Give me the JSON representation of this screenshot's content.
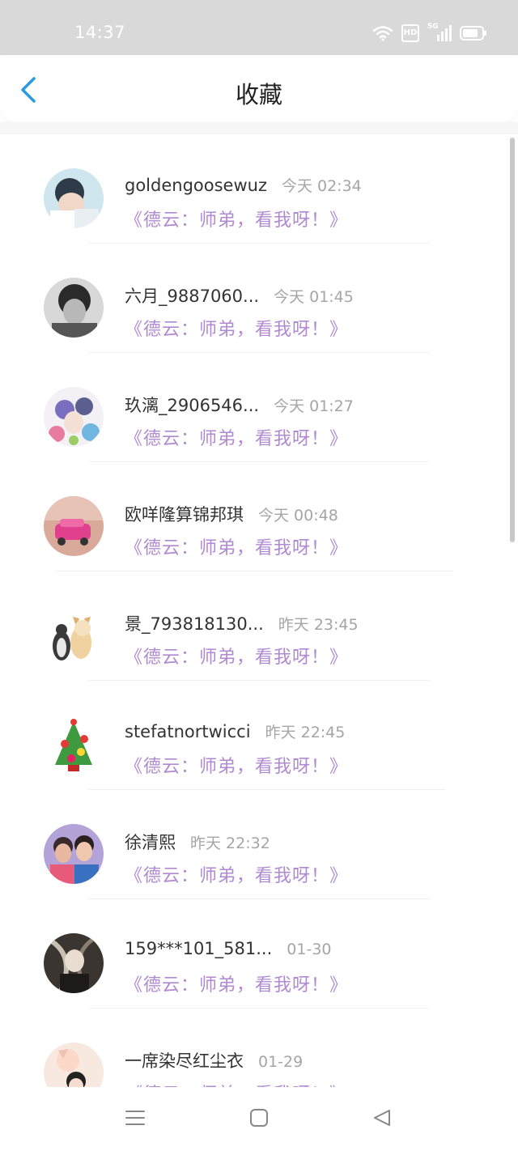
{
  "status_bar": {
    "time": "14:37",
    "hd_label": "HD",
    "network_label": "5G"
  },
  "header": {
    "title": "收藏"
  },
  "items": [
    {
      "name": "goldengoosewuz",
      "time": "今天 02:34",
      "subtitle": "《德云：师弟，看我呀！》"
    },
    {
      "name": "六月_9887060...",
      "time": "今天 01:45",
      "subtitle": "《德云：师弟，看我呀！》"
    },
    {
      "name": "玖漓_2906546...",
      "time": "今天 01:27",
      "subtitle": "《德云：师弟，看我呀！》"
    },
    {
      "name": "欧咩隆算锦邦琪",
      "time": "今天 00:48",
      "subtitle": "《德云：师弟，看我呀！》"
    },
    {
      "name": "景_793818130...",
      "time": "昨天 23:45",
      "subtitle": "《德云：师弟，看我呀！》"
    },
    {
      "name": "stefatnortwicci",
      "time": "昨天 22:45",
      "subtitle": "《德云：师弟，看我呀！》"
    },
    {
      "name": "徐清熙",
      "time": "昨天 22:32",
      "subtitle": "《德云：师弟，看我呀！》"
    },
    {
      "name": "159***101_581...",
      "time": "01-30",
      "subtitle": "《德云：师弟，看我呀！》"
    },
    {
      "name": "一席染尽红尘衣",
      "time": "01-29",
      "subtitle": "《德云：师弟，看我呀！》"
    }
  ],
  "icons": {
    "back": "chevron-left-icon",
    "wifi": "wifi-icon",
    "signal": "signal-icon",
    "battery": "battery-icon",
    "menu": "menu-icon",
    "home": "home-icon",
    "back_nav": "triangle-back-icon"
  },
  "colors": {
    "accent": "#2a9ae0",
    "subtitle": "#b08ad0",
    "status_bar": "#d9d9d9"
  }
}
